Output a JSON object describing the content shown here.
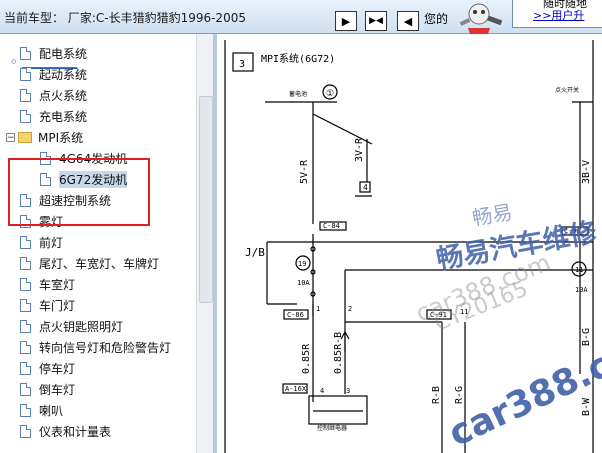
{
  "header": {
    "car_model": "当前车型： 厂家:C-长丰猎豹猎豹1996-2005",
    "your_text": "您的",
    "user_line1": "随时随地",
    "user_link": ">>用户升"
  },
  "tree": {
    "items": [
      {
        "label": "配电系统"
      },
      {
        "label": "起动系统"
      },
      {
        "label": "点火系统"
      },
      {
        "label": "充电系统"
      },
      {
        "label": "MPI系统"
      },
      {
        "label": "4G64发动机"
      },
      {
        "label": "6G72发动机"
      },
      {
        "label": "超速控制系统"
      },
      {
        "label": "雾灯"
      },
      {
        "label": "前灯"
      },
      {
        "label": "尾灯、车宽灯、车牌灯"
      },
      {
        "label": "车室灯"
      },
      {
        "label": "车门灯"
      },
      {
        "label": "点火钥匙照明灯"
      },
      {
        "label": "转向信号灯和危险警告灯"
      },
      {
        "label": "停车灯"
      },
      {
        "label": "倒车灯"
      },
      {
        "label": "喇叭"
      },
      {
        "label": "仪表和计量表"
      }
    ]
  },
  "diagram": {
    "section_number": "3",
    "title": "MPI系统(6G72)",
    "top_labels": [
      "蓄电池",
      "点火开关",
      "①"
    ],
    "wires": [
      "5V-R",
      "3V-R",
      "3B-V",
      "0.85R",
      "0.85R-B",
      "R-B",
      "R-G",
      "B-G",
      "B-W"
    ],
    "connectors": [
      "C-84",
      "C-99",
      "C-86",
      "C-91",
      "A-16X"
    ],
    "jb_label": "J/B",
    "fuse_numbers": [
      "19",
      "11"
    ],
    "fuse_ratings": [
      "10A",
      "10A"
    ],
    "pin_numbers": [
      "1",
      "2",
      "4",
      "3",
      "11"
    ],
    "ground": "4",
    "relay_label": "控制继电器",
    "watermarks": [
      "畅易",
      "畅易汽车维修",
      "car388.com",
      "CY20165",
      "car388.co"
    ]
  },
  "colors": {
    "accent": "#2a62b0",
    "highlight_border": "#e02020",
    "watermark": "#3f5fa8"
  }
}
